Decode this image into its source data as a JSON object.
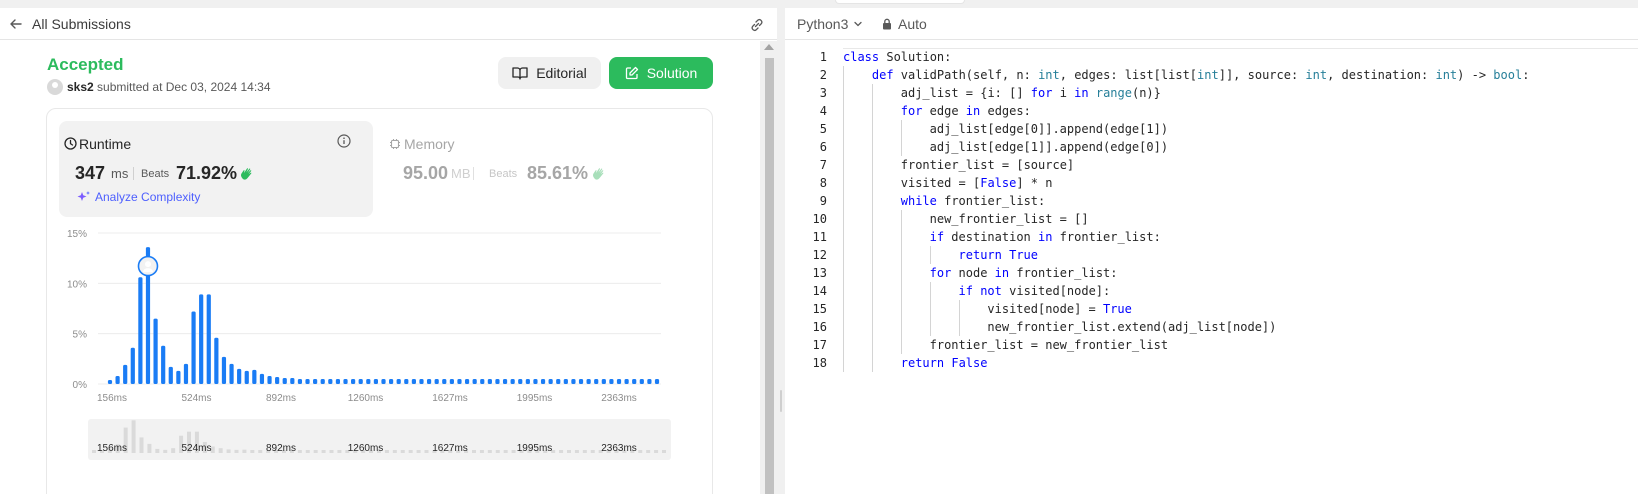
{
  "left_panel": {
    "back_label": "All Submissions",
    "status": "Accepted",
    "submitter": "sks2",
    "submitted_text": "submitted at Dec 03, 2024 14:34",
    "editorial_label": "Editorial",
    "solution_label": "Solution",
    "runtime": {
      "title": "Runtime",
      "value": "347",
      "unit": "ms",
      "beats_label": "Beats",
      "beats_pct": "71.92%",
      "analyze_label": "Analyze Complexity"
    },
    "memory": {
      "title": "Memory",
      "value": "95.00",
      "unit": "MB",
      "beats_label": "Beats",
      "beats_pct": "85.61%"
    }
  },
  "colors": {
    "accepted_green": "#2cbb5d",
    "bar_blue": "#1a7cf5",
    "keyword_blue": "#0000ff",
    "type_teal": "#267f99",
    "analyze_purple": "#4d5ffe"
  },
  "chart_data": {
    "type": "bar",
    "title": "",
    "xlabel": "",
    "ylabel": "",
    "y_ticks": [
      "15%",
      "10%",
      "5%",
      "0%"
    ],
    "ylim": [
      0,
      15
    ],
    "x_tick_labels": [
      "156ms",
      "524ms",
      "892ms",
      "1260ms",
      "1627ms",
      "1995ms",
      "2363ms"
    ],
    "values": [
      0.4,
      0.8,
      1.9,
      3.6,
      10.6,
      13.6,
      6.5,
      3.8,
      1.7,
      1.3,
      2.0,
      7.2,
      8.9,
      8.9,
      4.6,
      2.7,
      2.0,
      1.5,
      1.3,
      1.4,
      1.0,
      0.8,
      0.7,
      0.6,
      0.6,
      0.5,
      0.5,
      0.5,
      0.5,
      0.5,
      0.5,
      0.5,
      0.5,
      0.5,
      0.5,
      0.5,
      0.5,
      0.5,
      0.5,
      0.5,
      0.5,
      0.5,
      0.5,
      0.5,
      0.5,
      0.5,
      0.5,
      0.5,
      0.5,
      0.5,
      0.5,
      0.5,
      0.5,
      0.5,
      0.5,
      0.5,
      0.5,
      0.5,
      0.5,
      0.5,
      0.5,
      0.5,
      0.5,
      0.5,
      0.5,
      0.5,
      0.5,
      0.5,
      0.5,
      0.5,
      0.5,
      0.5,
      0.5
    ],
    "highlight_index": 5,
    "grid": true,
    "overview_x_tick_labels": [
      "156ms",
      "524ms",
      "892ms",
      "1260ms",
      "1627ms",
      "1995ms",
      "2363ms"
    ]
  },
  "editor": {
    "language": "Python3",
    "mode": "Auto",
    "lines": [
      {
        "n": "1",
        "indent": 0,
        "tokens": [
          [
            "kw",
            "class"
          ],
          [
            "t",
            " Solution:"
          ]
        ]
      },
      {
        "n": "2",
        "indent": 1,
        "tokens": [
          [
            "kw",
            "def"
          ],
          [
            "t",
            " validPath(self, n: "
          ],
          [
            "ty",
            "int"
          ],
          [
            "t",
            ", edges: list[list["
          ],
          [
            "ty",
            "int"
          ],
          [
            "t",
            "]], source: "
          ],
          [
            "ty",
            "int"
          ],
          [
            "t",
            ", destination: "
          ],
          [
            "ty",
            "int"
          ],
          [
            "t",
            ") -> "
          ],
          [
            "ty",
            "bool"
          ],
          [
            "t",
            ":"
          ]
        ]
      },
      {
        "n": "3",
        "indent": 2,
        "tokens": [
          [
            "t",
            "adj_list = {i: [] "
          ],
          [
            "kw",
            "for"
          ],
          [
            "t",
            " i "
          ],
          [
            "kw",
            "in"
          ],
          [
            "t",
            " "
          ],
          [
            "ty",
            "range"
          ],
          [
            "t",
            "(n)}"
          ]
        ]
      },
      {
        "n": "4",
        "indent": 2,
        "tokens": [
          [
            "kw",
            "for"
          ],
          [
            "t",
            " edge "
          ],
          [
            "kw",
            "in"
          ],
          [
            "t",
            " edges:"
          ]
        ]
      },
      {
        "n": "5",
        "indent": 3,
        "tokens": [
          [
            "t",
            "adj_list[edge[0]].append(edge[1])"
          ]
        ]
      },
      {
        "n": "6",
        "indent": 3,
        "tokens": [
          [
            "t",
            "adj_list[edge[1]].append(edge[0])"
          ]
        ]
      },
      {
        "n": "7",
        "indent": 2,
        "tokens": [
          [
            "t",
            "frontier_list = [source]"
          ]
        ]
      },
      {
        "n": "8",
        "indent": 2,
        "tokens": [
          [
            "t",
            "visited = ["
          ],
          [
            "kw",
            "False"
          ],
          [
            "t",
            "] * n"
          ]
        ]
      },
      {
        "n": "9",
        "indent": 2,
        "tokens": [
          [
            "kw",
            "while"
          ],
          [
            "t",
            " frontier_list:"
          ]
        ]
      },
      {
        "n": "10",
        "indent": 3,
        "tokens": [
          [
            "t",
            "new_frontier_list = []"
          ]
        ]
      },
      {
        "n": "11",
        "indent": 3,
        "tokens": [
          [
            "kw",
            "if"
          ],
          [
            "t",
            " destination "
          ],
          [
            "kw",
            "in"
          ],
          [
            "t",
            " frontier_list:"
          ]
        ]
      },
      {
        "n": "12",
        "indent": 4,
        "tokens": [
          [
            "kw",
            "return"
          ],
          [
            "t",
            " "
          ],
          [
            "kw",
            "True"
          ]
        ]
      },
      {
        "n": "13",
        "indent": 3,
        "tokens": [
          [
            "kw",
            "for"
          ],
          [
            "t",
            " node "
          ],
          [
            "kw",
            "in"
          ],
          [
            "t",
            " frontier_list:"
          ]
        ]
      },
      {
        "n": "14",
        "indent": 4,
        "tokens": [
          [
            "kw",
            "if"
          ],
          [
            "t",
            " "
          ],
          [
            "kw",
            "not"
          ],
          [
            "t",
            " visited[node]:"
          ]
        ]
      },
      {
        "n": "15",
        "indent": 5,
        "tokens": [
          [
            "t",
            "visited[node] = "
          ],
          [
            "kw",
            "True"
          ]
        ]
      },
      {
        "n": "16",
        "indent": 5,
        "tokens": [
          [
            "t",
            "new_frontier_list.extend(adj_list[node])"
          ]
        ]
      },
      {
        "n": "17",
        "indent": 3,
        "tokens": [
          [
            "t",
            "frontier_list = new_frontier_list"
          ]
        ]
      },
      {
        "n": "18",
        "indent": 2,
        "tokens": [
          [
            "kw",
            "return"
          ],
          [
            "t",
            " "
          ],
          [
            "kw",
            "False"
          ]
        ]
      }
    ]
  }
}
